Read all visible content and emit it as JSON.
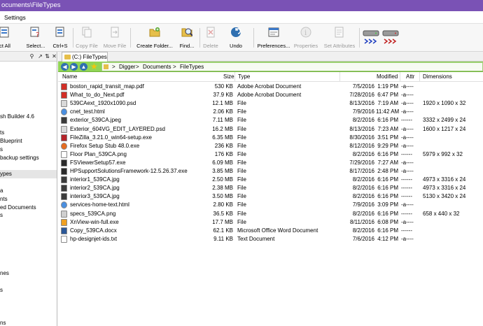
{
  "window": {
    "title": "ocuments\\FileTypes"
  },
  "menu": {
    "items": [
      "Settings"
    ]
  },
  "toolbar": {
    "buttons": [
      {
        "name": "select-all",
        "label": "ct All",
        "icon": "select-all-icon",
        "enabled": true
      },
      {
        "name": "select",
        "label": "Select...",
        "icon": "select-icon",
        "enabled": true
      },
      {
        "name": "select-ctrl",
        "label": "Ctrl+S",
        "icon": "select-pattern-icon",
        "enabled": true
      },
      {
        "name": "copy-file",
        "label": "Copy File",
        "icon": "copy-file-icon",
        "enabled": false
      },
      {
        "name": "move-file",
        "label": "Move File",
        "icon": "move-file-icon",
        "enabled": false
      },
      {
        "name": "create-folder",
        "label": "Create Folder...",
        "icon": "new-folder-icon",
        "enabled": true
      },
      {
        "name": "find",
        "label": "Find...",
        "icon": "find-icon",
        "enabled": true
      },
      {
        "name": "delete",
        "label": "Delete",
        "icon": "delete-icon",
        "enabled": false
      },
      {
        "name": "undo",
        "label": "Undo",
        "icon": "undo-icon",
        "enabled": true
      },
      {
        "name": "preferences",
        "label": "Preferences...",
        "icon": "preferences-icon",
        "enabled": true
      },
      {
        "name": "properties",
        "label": "Properties",
        "icon": "properties-icon",
        "enabled": false
      },
      {
        "name": "set-attributes",
        "label": "Set Attributes",
        "icon": "set-attributes-icon",
        "enabled": false
      },
      {
        "name": "drives",
        "label": "",
        "icon": "drive-transfer-icon",
        "enabled": true
      }
    ]
  },
  "left_pane": {
    "items": [
      {
        "label": "",
        "selected": false
      },
      {
        "label": "",
        "selected": false
      },
      {
        "label": "",
        "selected": false
      },
      {
        "label": "",
        "selected": false
      },
      {
        "label": "",
        "selected": false
      },
      {
        "label": "",
        "selected": false
      },
      {
        "label": "sh Builder 4.6",
        "selected": false
      },
      {
        "label": "",
        "selected": false
      },
      {
        "label": "ts",
        "selected": false
      },
      {
        "label": "Blueprint",
        "selected": false
      },
      {
        "label": "s",
        "selected": false
      },
      {
        "label": "backup settings",
        "selected": false
      },
      {
        "label": "",
        "selected": false
      },
      {
        "label": "ypes",
        "selected": true
      },
      {
        "label": "",
        "selected": false
      },
      {
        "label": "a",
        "selected": false
      },
      {
        "label": "nts",
        "selected": false
      },
      {
        "label": "ed Documents",
        "selected": false
      },
      {
        "label": "s",
        "selected": false
      },
      {
        "label": "",
        "selected": false
      },
      {
        "label": "",
        "selected": false
      },
      {
        "label": "",
        "selected": false
      },
      {
        "label": "",
        "selected": false
      },
      {
        "label": "",
        "selected": false
      },
      {
        "label": "",
        "selected": false
      },
      {
        "label": "nes",
        "selected": false
      },
      {
        "label": "",
        "selected": false
      },
      {
        "label": "s",
        "selected": false
      },
      {
        "label": "",
        "selected": false
      },
      {
        "label": "",
        "selected": false
      },
      {
        "label": "",
        "selected": false
      },
      {
        "label": "ns",
        "selected": false
      }
    ]
  },
  "tab": {
    "label": "(C:) FileTypes"
  },
  "breadcrumb": {
    "items": [
      "Digger",
      "Documents",
      "FileTypes"
    ],
    "separator": ">"
  },
  "columns": {
    "name": "Name",
    "size": "Size",
    "type": "Type",
    "modified": "Modified",
    "attr": "Attr",
    "dimensions": "Dimensions"
  },
  "files": [
    {
      "name": "boston_rapid_transit_map.pdf",
      "size": "530 KB",
      "type": "Adobe Acrobat Document",
      "date": "7/5/2016",
      "time": "1:19 PM",
      "attr": "-a----",
      "dim": "",
      "icon": "pdf-icon",
      "color": "#d22f27"
    },
    {
      "name": "What_to_do_Next.pdf",
      "size": "37.9 KB",
      "type": "Adobe Acrobat Document",
      "date": "7/28/2016",
      "time": "6:47 PM",
      "attr": "-a----",
      "dim": "",
      "icon": "pdf-icon",
      "color": "#d22f27"
    },
    {
      "name": "539CAext_1920x1090.psd",
      "size": "12.1 MB",
      "type": "File",
      "date": "8/13/2016",
      "time": "7:19 AM",
      "attr": "-a----",
      "dim": "1920 x 1090 x 32",
      "icon": "file-icon",
      "color": "#d9d9d9"
    },
    {
      "name": "cnet_test.html",
      "size": "2.06 KB",
      "type": "File",
      "date": "7/9/2016",
      "time": "11:42 AM",
      "attr": "-a----",
      "dim": "",
      "icon": "chrome-icon",
      "color": "#4a8fe0"
    },
    {
      "name": "exterior_539CA.jpeg",
      "size": "7.11 MB",
      "type": "File",
      "date": "8/2/2016",
      "time": "6:16 PM",
      "attr": "------",
      "dim": "3332 x 2499 x 24",
      "icon": "image-icon",
      "color": "#3b3b3b"
    },
    {
      "name": "Exterior_604VG_EDIT_LAYERED.psd",
      "size": "16.2 MB",
      "type": "File",
      "date": "8/13/2016",
      "time": "7:23 AM",
      "attr": "-a----",
      "dim": "1600 x 1217 x 24",
      "icon": "file-icon",
      "color": "#d9d9d9"
    },
    {
      "name": "FileZilla_3.21.0_win64-setup.exe",
      "size": "6.35 MB",
      "type": "File",
      "date": "8/30/2016",
      "time": "3:51 PM",
      "attr": "-a----",
      "dim": "",
      "icon": "filezilla-icon",
      "color": "#b5242a"
    },
    {
      "name": "Firefox Setup Stub 48.0.exe",
      "size": "236 KB",
      "type": "File",
      "date": "8/12/2016",
      "time": "9:29 PM",
      "attr": "-a----",
      "dim": "",
      "icon": "firefox-icon",
      "color": "#e66b1f"
    },
    {
      "name": "Floor Plan_539CA.png",
      "size": "176 KB",
      "type": "File",
      "date": "8/2/2016",
      "time": "6:16 PM",
      "attr": "------",
      "dim": "5979 x 992 x 32",
      "icon": "image-icon",
      "color": "#ffffff"
    },
    {
      "name": "FSViewerSetup57.exe",
      "size": "6.09 MB",
      "type": "File",
      "date": "7/29/2016",
      "time": "7:27 AM",
      "attr": "-a----",
      "dim": "",
      "icon": "installer-icon",
      "color": "#2b2b2b"
    },
    {
      "name": "HPSupportSolutionsFramework-12.5.26.37.exe",
      "size": "3.85 MB",
      "type": "File",
      "date": "8/17/2016",
      "time": "2:48 PM",
      "attr": "-a----",
      "dim": "",
      "icon": "installer-icon",
      "color": "#2b2b2b"
    },
    {
      "name": "interior1_539CA.jpg",
      "size": "2.50 MB",
      "type": "File",
      "date": "8/2/2016",
      "time": "6:16 PM",
      "attr": "------",
      "dim": "4973 x 3316 x 24",
      "icon": "image-icon",
      "color": "#3b3b3b"
    },
    {
      "name": "interior2_539CA.jpg",
      "size": "2.38 MB",
      "type": "File",
      "date": "8/2/2016",
      "time": "6:16 PM",
      "attr": "------",
      "dim": "4973 x 3316 x 24",
      "icon": "image-icon",
      "color": "#3b3b3b"
    },
    {
      "name": "interior3_539CA.jpg",
      "size": "3.50 MB",
      "type": "File",
      "date": "8/2/2016",
      "time": "6:16 PM",
      "attr": "------",
      "dim": "5130 x 3420 x 24",
      "icon": "image-icon",
      "color": "#3b3b3b"
    },
    {
      "name": "services-home-text.html",
      "size": "2.80 KB",
      "type": "File",
      "date": "7/9/2016",
      "time": "3:09 PM",
      "attr": "-a----",
      "dim": "",
      "icon": "chrome-icon",
      "color": "#4a8fe0"
    },
    {
      "name": "specs_539CA.png",
      "size": "36.5 KB",
      "type": "File",
      "date": "8/2/2016",
      "time": "6:16 PM",
      "attr": "------",
      "dim": "658 x 440 x 32",
      "icon": "image-icon",
      "color": "#cfcfcf"
    },
    {
      "name": "XnView-win-full.exe",
      "size": "17.7 MB",
      "type": "File",
      "date": "8/11/2016",
      "time": "6:08 PM",
      "attr": "-a----",
      "dim": "",
      "icon": "xnview-icon",
      "color": "#f0a020"
    },
    {
      "name": "Copy_539CA.docx",
      "size": "62.1 KB",
      "type": "Microsoft Office Word Document",
      "date": "8/2/2016",
      "time": "6:16 PM",
      "attr": "------",
      "dim": "",
      "icon": "word-icon",
      "color": "#2b5797"
    },
    {
      "name": "hp-designjet-ids.txt",
      "size": "9.11 KB",
      "type": "Text Document",
      "date": "7/6/2016",
      "time": "4:12 PM",
      "attr": "-a----",
      "dim": "",
      "icon": "text-file-icon",
      "color": "#ffffff"
    }
  ],
  "colors": {
    "titlebar": "#7a52b5",
    "navbar": "#91d556",
    "accent": "#2f6fb0"
  }
}
